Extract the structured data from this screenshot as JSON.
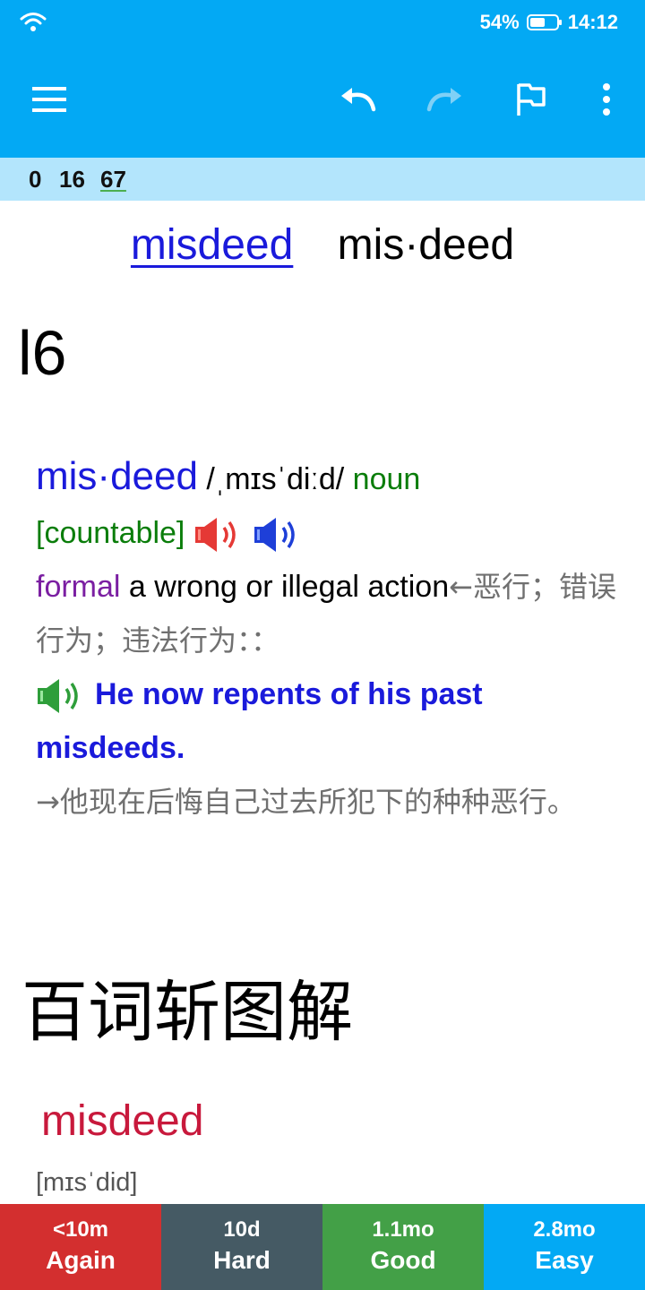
{
  "status_bar": {
    "battery": "54%",
    "time": "14:12"
  },
  "icons": {
    "menu": "hamburger-menu-icon",
    "undo": "undo-icon",
    "redo": "redo-icon",
    "flag": "flag-icon",
    "more": "more-vert-icon",
    "speaker_uk": "speaker-red-icon",
    "speaker_us": "speaker-blue-icon",
    "speaker_example": "speaker-green-icon"
  },
  "counts": {
    "new": "0",
    "learning": "16",
    "review": "67"
  },
  "card": {
    "headword_link": "misdeed",
    "headword_syllables": "mis·deed",
    "level": "l6",
    "entry": {
      "word": "mis·deed",
      "pronunciation": "/ˌmɪsˈdiːd/",
      "pos": "noun",
      "grammar": "[countable]",
      "register": "formal",
      "definition": "a wrong or illegal action",
      "definition_cn": "←恶行；错误行为；违法行为：：",
      "example": "He now repents of his past misdeeds.",
      "example_cn": "→他现在后悔自己过去所犯下的种种恶行。"
    },
    "section_title": "百词斩图解",
    "bc_word": "misdeed",
    "bc_pron": "[mɪsˈdid]"
  },
  "answers": [
    {
      "interval": "<10m",
      "label": "Again",
      "color": "#d32f2f"
    },
    {
      "interval": "10d",
      "label": "Hard",
      "color": "#455a64"
    },
    {
      "interval": "1.1mo",
      "label": "Good",
      "color": "#43a047"
    },
    {
      "interval": "2.8mo",
      "label": "Easy",
      "color": "#03a9f4"
    }
  ],
  "colors": {
    "accent": "#03a9f4",
    "count_bar": "#b3e5fc",
    "link_blue": "#1a1adb",
    "grammar_green": "#0a7d0a",
    "register_purple": "#7b1fa2",
    "bc_word_red": "#c8193c"
  }
}
